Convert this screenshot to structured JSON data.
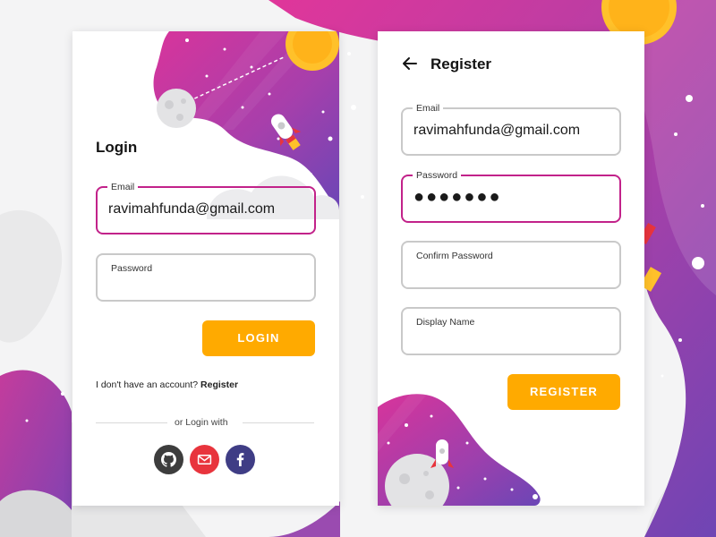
{
  "colors": {
    "accent": "#c2228a",
    "button": "#ffaa00",
    "purple": "#7a3fb5",
    "magenta": "#d4318f",
    "sun": "#ffc12a",
    "github": "#3d3d3d",
    "gmail": "#e8343d",
    "facebook": "#3f3d85"
  },
  "login": {
    "title": "Login",
    "email_label": "Email",
    "email_value": "ravimahfunda@gmail.com",
    "password_label": "Password",
    "button": "LOGIN",
    "no_account_text": "I don't have an account?",
    "register_link": "Register",
    "or_login_with": "or Login with",
    "social": [
      {
        "name": "github",
        "icon": "github-icon"
      },
      {
        "name": "gmail",
        "icon": "mail-icon"
      },
      {
        "name": "facebook",
        "icon": "facebook-icon"
      }
    ]
  },
  "register": {
    "back_icon": "arrow-left-icon",
    "title": "Register",
    "email_label": "Email",
    "email_value": "ravimahfunda@gmail.com",
    "password_label": "Password",
    "password_value": "●●●●●●●",
    "confirm_label": "Confirm Password",
    "display_name_label": "Display Name",
    "button": "REGISTER"
  }
}
